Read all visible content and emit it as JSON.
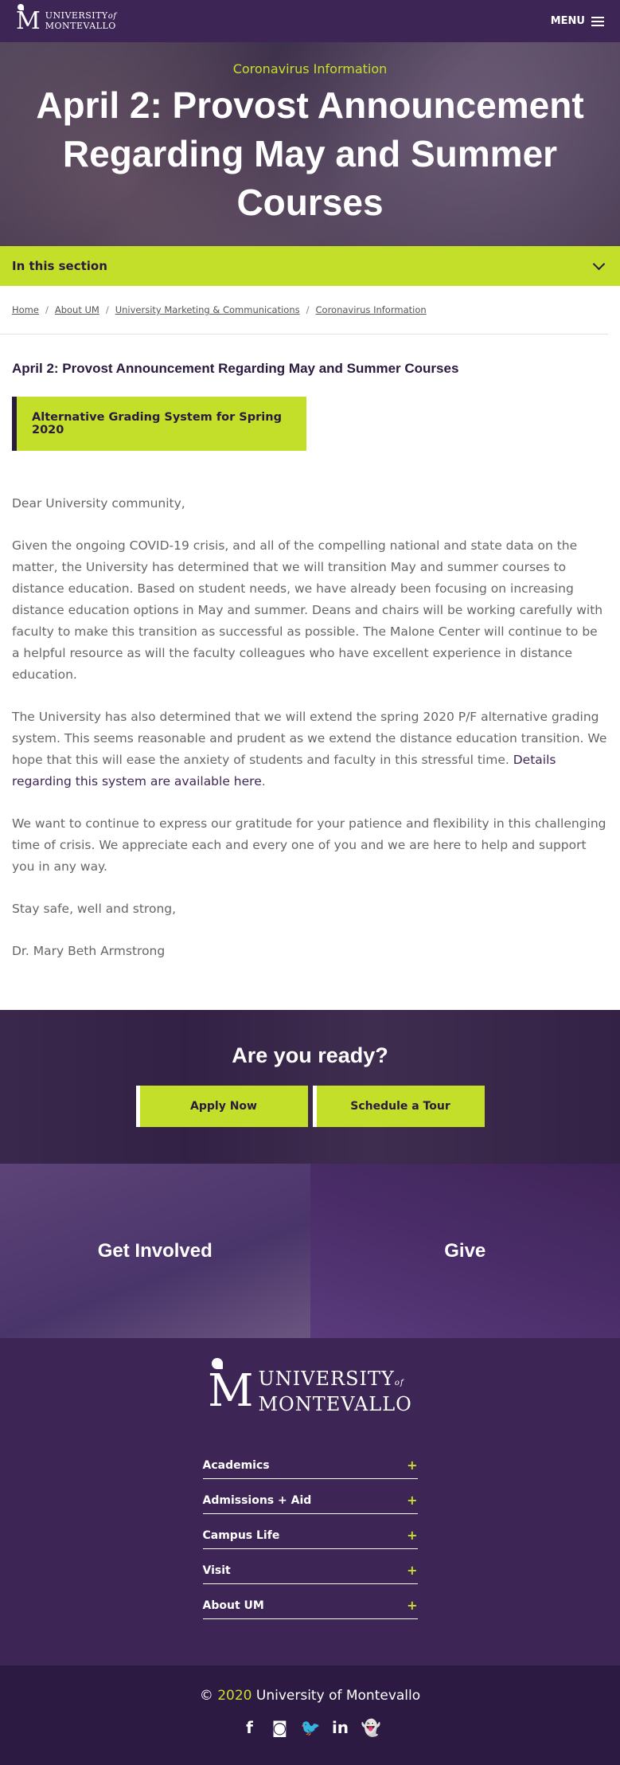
{
  "header": {
    "logo_line1": "UNIVERSITY",
    "logo_of": "of",
    "logo_line2": "MONTEVALLO",
    "menu_label": "MENU"
  },
  "hero": {
    "kicker": "Coronavirus Information",
    "title": "April 2: Provost Announcement Regarding May and Summer Courses"
  },
  "section_nav": {
    "label": "In this section"
  },
  "breadcrumb": [
    {
      "label": "Home"
    },
    {
      "label": "About UM"
    },
    {
      "label": "University Marketing & Communications"
    },
    {
      "label": "Coronavirus Information"
    }
  ],
  "main": {
    "title": "April 2: Provost Announcement Regarding May and Summer Courses",
    "callout": "Alternative Grading System for Spring 2020",
    "greeting": "Dear University community,",
    "p1": "Given the ongoing COVID-19 crisis, and all of the compelling national and state data on the matter, the University has determined that we will transition May and summer courses to distance education. Based on student needs, we have already been focusing on increasing distance education options in May and summer. Deans and chairs will be working carefully with faculty to make this transition as successful as possible. The Malone Center will continue to be a helpful resource as will the faculty colleagues who have excellent experience in distance education.",
    "p2": "The University has also determined that we will extend the spring 2020 P/F alternative grading system. This seems reasonable and prudent as we extend the distance education transition. We hope that this will ease the anxiety of students and faculty in this stressful time.",
    "p2_link": "Details regarding this system are available here",
    "p2_end": ".",
    "p3": "We want to continue to express our gratitude for your patience and flexibility in this challenging time of crisis. We appreciate each and every one of you and we are here to help and support you in any way.",
    "closing": "Stay safe, well and strong,",
    "signature": "Dr. Mary Beth Armstrong"
  },
  "ready": {
    "title": "Are you ready?",
    "apply": "Apply Now",
    "tour": "Schedule a Tour"
  },
  "tiles": {
    "involved": "Get Involved",
    "give": "Give"
  },
  "footer": {
    "logo_line1": "UNIVERSITY",
    "logo_of": "of",
    "logo_line2": "MONTEVALLO",
    "nav": [
      {
        "label": "Academics",
        "icon": "+"
      },
      {
        "label": "Admissions + Aid",
        "icon": "+"
      },
      {
        "label": "Campus Life",
        "icon": "+"
      },
      {
        "label": "Visit",
        "icon": "+"
      },
      {
        "label": "About UM",
        "icon": "+"
      }
    ],
    "copyright_symbol": "©",
    "copyright_year": "2020",
    "copyright_name": "University of Montevallo",
    "social": [
      {
        "name": "facebook-icon",
        "glyph": "f"
      },
      {
        "name": "instagram-icon",
        "glyph": "◙"
      },
      {
        "name": "twitter-icon",
        "glyph": "🐦"
      },
      {
        "name": "linkedin-icon",
        "glyph": "in"
      },
      {
        "name": "snapchat-icon",
        "glyph": "👻"
      }
    ]
  },
  "colors": {
    "purple": "#3d2655",
    "lime": "#c3df2a",
    "dark_purple": "#2d1a43"
  }
}
